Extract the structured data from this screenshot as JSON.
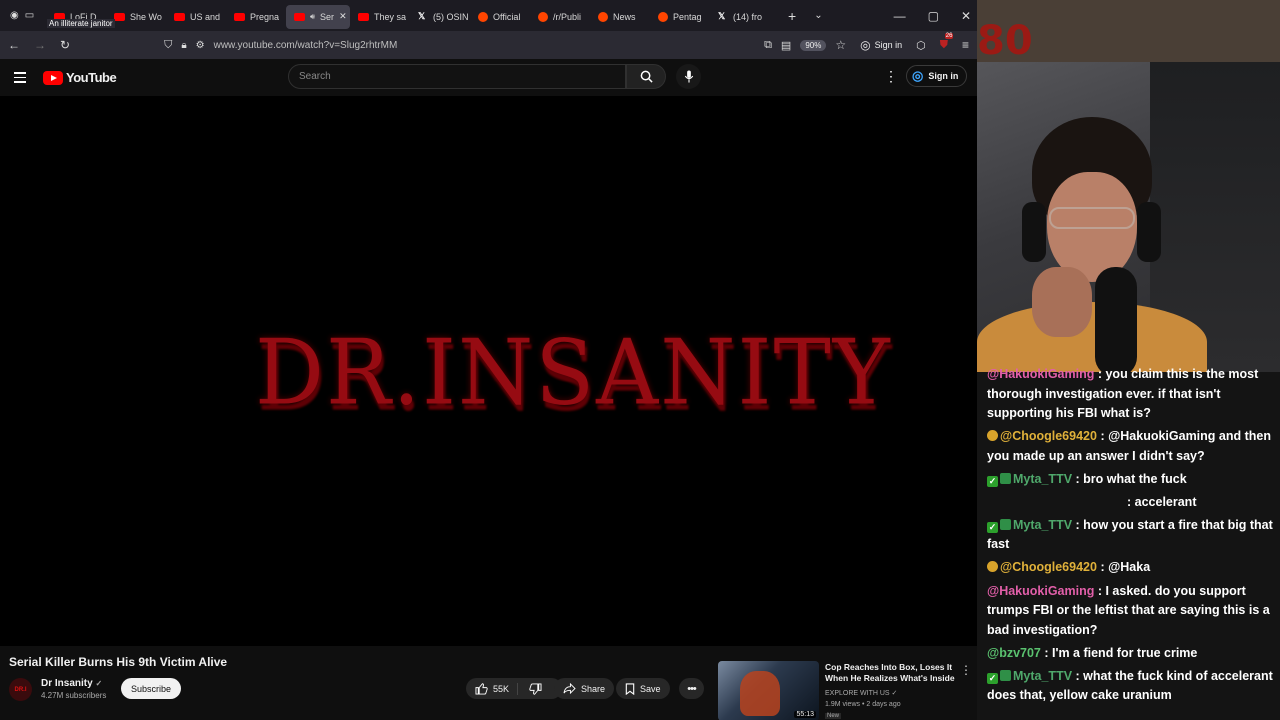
{
  "browser": {
    "tab_tooltip": "An illiterate janitor",
    "tabs": [
      {
        "label": "LoFi D",
        "icon": "youtube-icon",
        "active": false
      },
      {
        "label": "She Wo",
        "icon": "youtube-icon",
        "active": false
      },
      {
        "label": "US and",
        "icon": "youtube-icon",
        "active": false
      },
      {
        "label": "Pregna",
        "icon": "youtube-icon",
        "active": false
      },
      {
        "label": "Ser",
        "icon": "youtube-icon",
        "active": true
      },
      {
        "label": "They sa",
        "icon": "youtube-icon",
        "active": false
      },
      {
        "label": "(5) OSIN",
        "icon": "x-icon",
        "active": false
      },
      {
        "label": "Official",
        "icon": "reddit-icon",
        "active": false
      },
      {
        "label": "/r/Publi",
        "icon": "reddit-icon",
        "active": false
      },
      {
        "label": "News",
        "icon": "reddit-icon",
        "active": false
      },
      {
        "label": "Pentag",
        "icon": "reddit-icon",
        "active": false
      },
      {
        "label": "(14) fro",
        "icon": "x-icon",
        "active": false
      }
    ],
    "url": "www.youtube.com/watch?v=Slug2rhtrMM",
    "zoom": "90%",
    "signin_label": "Sign in",
    "extension_badge": "26"
  },
  "youtube": {
    "logo_text": "YouTube",
    "search_placeholder": "Search",
    "signin_label": "Sign in",
    "video_art_text": "DR.INSANITY",
    "video_title": "Serial Killer Burns His 9th Victim Alive",
    "channel": {
      "name": "Dr Insanity",
      "subscribers": "4.27M subscribers",
      "avatar_text": "DR.I"
    },
    "subscribe_label": "Subscribe",
    "likes": "55K",
    "share_label": "Share",
    "save_label": "Save",
    "recommendation": {
      "title": "Cop Reaches Into Box, Loses It When He Realizes What's Inside",
      "channel": "EXPLORE WITH US",
      "stats": "1.9M views • 2 days ago",
      "duration": "55:13",
      "badge": "New"
    }
  },
  "stream_overlay": {
    "banner_text": "80",
    "chat": [
      {
        "user": "@HakuokiGaming",
        "user_color": "#e25fa9",
        "badges": [],
        "text": ": you claim this is the most thorough investigation ever. if that isn't supporting his FBI what is?"
      },
      {
        "user": "@Choogle69420",
        "user_color": "#e0b13a",
        "badges": [
          "coin"
        ],
        "text": ": @HakuokiGaming and then you made up an answer I didn't say?"
      },
      {
        "user": "Myta_TTV",
        "user_color": "#4fa86b",
        "badges": [
          "check",
          "star"
        ],
        "text": ": bro what the fuck"
      },
      {
        "user": "",
        "user_color": "#ffffff",
        "badges": [],
        "text": ": accelerant"
      },
      {
        "user": "Myta_TTV",
        "user_color": "#4fa86b",
        "badges": [
          "check",
          "star"
        ],
        "text": ": how you start a fire that big that fast"
      },
      {
        "user": "@Choogle69420",
        "user_color": "#e0b13a",
        "badges": [
          "coin"
        ],
        "text": ": @Haka"
      },
      {
        "user": "@HakuokiGaming",
        "user_color": "#e25fa9",
        "badges": [],
        "text": ": I asked. do you support trumps FBI or the leftist that are saying this is a bad investigation?"
      },
      {
        "user": "@bzv707",
        "user_color": "#5ac26f",
        "badges": [],
        "text": ": I'm a fiend for true crime"
      },
      {
        "user": "Myta_TTV",
        "user_color": "#4fa86b",
        "badges": [
          "check",
          "star"
        ],
        "text": ": what the fuck kind of accelerant does that, yellow cake uranium"
      }
    ]
  }
}
